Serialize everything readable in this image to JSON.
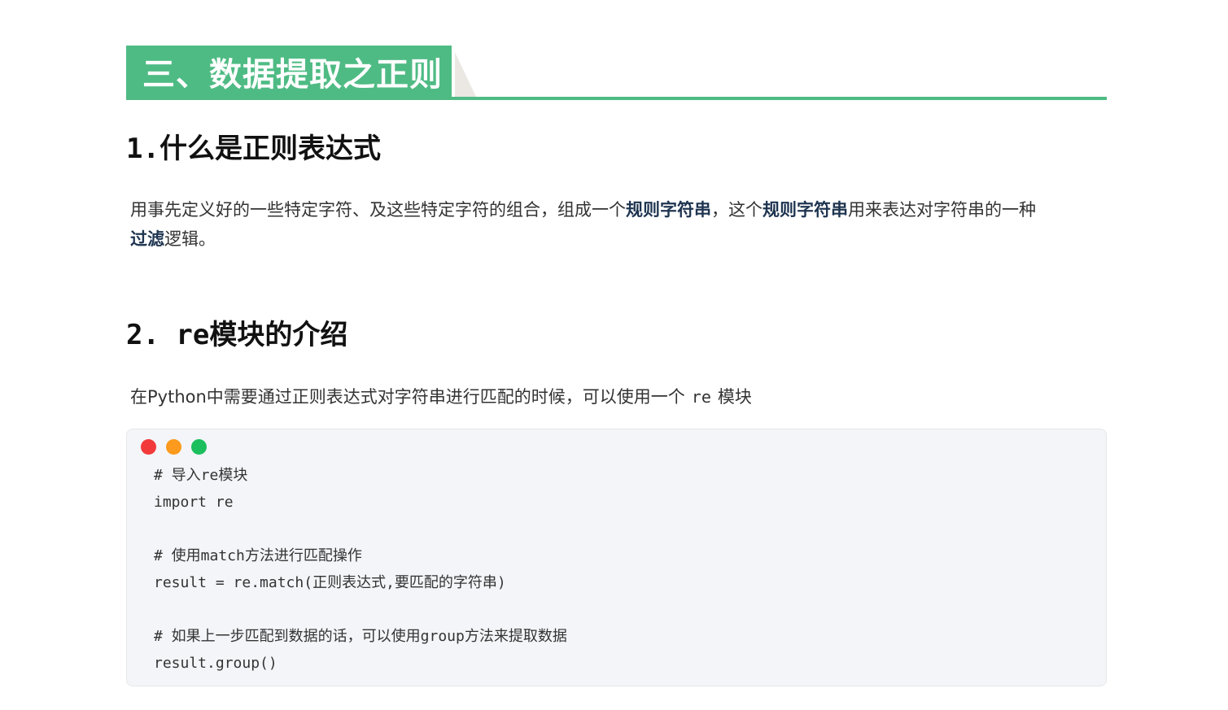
{
  "section": {
    "title": "三、数据提取之正则"
  },
  "s1": {
    "heading_num": "1.",
    "heading_text": "什么是正则表达式",
    "para": {
      "t1": "用事先定义好的一些特定字符、及这些特定字符的组合，组成一个",
      "b1": "规则字符串",
      "t2": "，这个",
      "b2": "规则字符串",
      "t3": "用来表达对字符串的一种",
      "b3": "过滤",
      "t4": "逻辑。"
    }
  },
  "s2": {
    "heading_num": "2. ",
    "heading_text": "re模块的介绍",
    "para": {
      "t1": "在Python中需要通过正则表达式对字符串进行匹配的时候，可以使用一个",
      "code": "re",
      "t2": "模块"
    }
  },
  "code_block": {
    "dot_colors": [
      "#f33a3a",
      "#fb9a1c",
      "#1bbf5e"
    ],
    "lines": [
      "# 导入re模块",
      "import re",
      "",
      "# 使用match方法进行匹配操作",
      "result = re.match(正则表达式,要匹配的字符串)",
      "",
      "# 如果上一步匹配到数据的话，可以使用group方法来提取数据",
      "result.group()"
    ]
  }
}
